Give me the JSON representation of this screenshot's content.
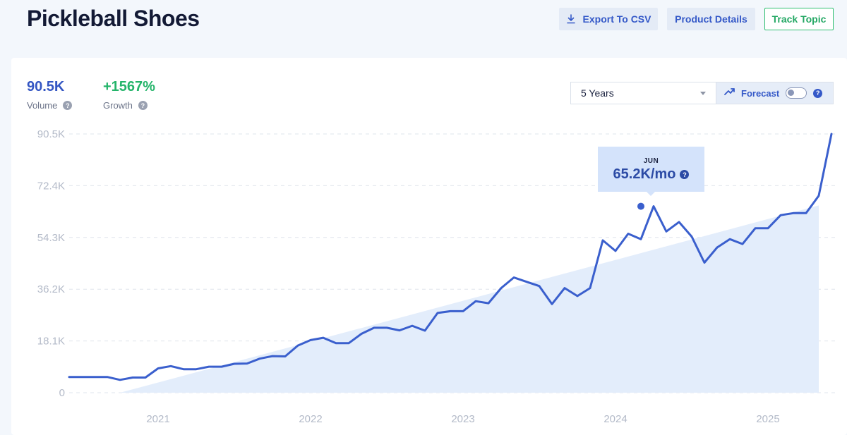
{
  "header": {
    "title": "Pickleball Shoes",
    "export_label": "Export To CSV",
    "details_label": "Product Details",
    "track_label": "Track Topic"
  },
  "stats": {
    "volume_value": "90.5K",
    "volume_label": "Volume",
    "growth_value": "+1567%",
    "growth_label": "Growth"
  },
  "controls": {
    "range_value": "5 Years",
    "forecast_label": "Forecast",
    "forecast_enabled": false
  },
  "tooltip": {
    "month": "JUN",
    "value": "65.2K/mo"
  },
  "colors": {
    "line": "#3a5fcd",
    "trend_fill": "#e3edfb",
    "volume": "#3456c3",
    "growth": "#24b46a"
  },
  "chart_data": {
    "type": "line",
    "title": "",
    "xlabel": "",
    "ylabel": "",
    "x_ticks": [
      "2021",
      "2022",
      "2023",
      "2024",
      "2025"
    ],
    "y_ticks": [
      "0",
      "18.1K",
      "36.2K",
      "54.3K",
      "72.4K",
      "90.5K"
    ],
    "ylim": [
      0,
      90500
    ],
    "grid": "horizontal-dashed",
    "x_start": "2020-09",
    "series": [
      {
        "values": [
          5500,
          5500,
          5500,
          5500,
          4500,
          5300,
          5300,
          8500,
          9300,
          8200,
          8200,
          9100,
          9100,
          10100,
          10200,
          11900,
          12800,
          12700,
          16500,
          18400,
          19200,
          17300,
          17300,
          20600,
          22700,
          22700,
          21800,
          23400,
          21700,
          27900,
          28500,
          28500,
          32000,
          31300,
          36600,
          40300,
          38800,
          37300,
          31000,
          36600,
          33800,
          36600,
          53300,
          49600,
          55600,
          53700,
          65200,
          56400,
          59700,
          54600,
          45500,
          50800,
          53700,
          52000,
          57500,
          57500,
          62100,
          62800,
          62800,
          68900,
          90500
        ]
      }
    ],
    "trend": {
      "start": [
        "2021-01",
        0
      ],
      "end": [
        "2025-08",
        65500
      ]
    },
    "highlight": {
      "label": "JUN",
      "x": "2024-06",
      "y": 65200
    }
  }
}
